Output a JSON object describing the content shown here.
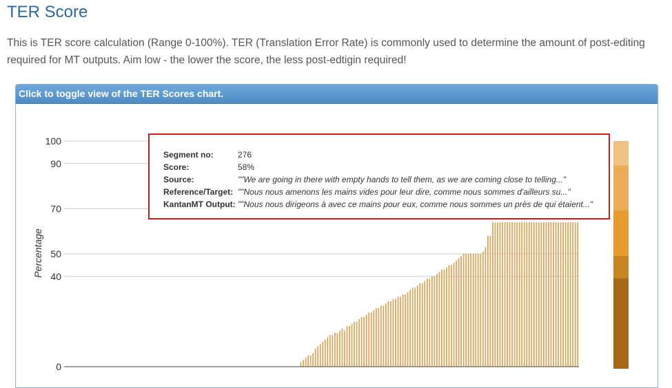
{
  "page": {
    "title": "TER Score",
    "intro": "This is TER score calculation (Range 0-100%). TER (Translation Error Rate) is commonly used to determine the amount of post-editing required for MT outputs. Aim low - the lower the score, the less post-edtigin required!"
  },
  "panel": {
    "header": "Click to toggle view of the TER Scores chart."
  },
  "tooltip": {
    "segment_label": "Segment no:",
    "segment_value": "276",
    "score_label": "Score:",
    "score_value": "58%",
    "source_label": "Source:",
    "source_value": "\"\"We are going in there with empty hands to tell them, as we are coming close to telling...\"",
    "reference_label": "Reference/Target:",
    "reference_value": "\"\"Nous nous amenons les mains vides pour leur dire, comme nous sommes d'ailleurs su...\"",
    "output_label": "KantanMT Output:",
    "output_value": "\"\"Nous nous dirigeons à avec ce mains pour eux, comme nous sommes un près de qui étaient...\""
  },
  "chart_data": {
    "type": "bar",
    "ylabel": "Percentage",
    "xlabel": "",
    "ylim": [
      0,
      100
    ],
    "yticks": [
      0,
      40,
      50,
      70,
      90,
      100
    ],
    "grid": true,
    "bar_color": "#d9a55a",
    "bar_count": 206,
    "values": [
      0,
      0,
      0,
      0,
      0,
      0,
      0,
      0,
      0,
      0,
      0,
      0,
      0,
      0,
      0,
      0,
      0,
      0,
      0,
      0,
      0,
      0,
      0,
      0,
      0,
      0,
      0,
      0,
      0,
      0,
      0,
      0,
      0,
      0,
      0,
      0,
      0,
      0,
      0,
      0,
      0,
      0,
      0,
      0,
      0,
      0,
      0,
      0,
      0,
      0,
      0,
      0,
      0,
      0,
      0,
      0,
      0,
      0,
      0,
      0,
      0,
      0,
      0,
      0,
      0,
      0,
      0,
      0,
      0,
      0,
      0,
      0,
      0,
      0,
      0,
      0,
      0,
      0,
      0,
      0,
      0,
      0,
      0,
      0,
      0,
      0,
      0,
      0,
      0,
      0,
      0,
      0,
      0,
      0,
      0,
      0,
      0,
      2,
      3,
      4,
      5,
      5,
      6,
      8,
      9,
      10,
      11,
      12,
      13,
      14,
      14,
      15,
      15,
      16,
      17,
      16,
      18,
      18,
      19,
      20,
      20,
      21,
      22,
      22,
      23,
      24,
      24,
      25,
      26,
      26,
      27,
      27,
      28,
      29,
      29,
      30,
      30,
      31,
      31,
      32,
      32,
      33,
      34,
      35,
      35,
      36,
      37,
      37,
      38,
      39,
      39,
      40,
      40,
      41,
      42,
      43,
      43,
      44,
      45,
      45,
      46,
      47,
      48,
      49,
      50,
      50,
      50,
      50,
      50,
      50,
      50,
      50,
      51,
      53,
      58,
      58,
      64,
      64,
      64,
      64,
      64,
      64,
      64,
      64,
      64,
      64,
      64,
      64,
      64,
      64,
      64,
      64,
      64,
      64,
      64,
      64,
      64,
      64,
      64,
      64,
      64,
      64,
      64,
      64,
      64,
      64,
      64,
      64,
      64,
      64,
      64,
      64
    ],
    "legend_scale": [
      {
        "from": 0,
        "to": 40,
        "color": "#a66a16"
      },
      {
        "from": 40,
        "to": 50,
        "color": "#c98424"
      },
      {
        "from": 50,
        "to": 70,
        "color": "#e59b2d"
      },
      {
        "from": 70,
        "to": 90,
        "color": "#eaac57"
      },
      {
        "from": 90,
        "to": 100,
        "color": "#efc07f"
      }
    ]
  }
}
